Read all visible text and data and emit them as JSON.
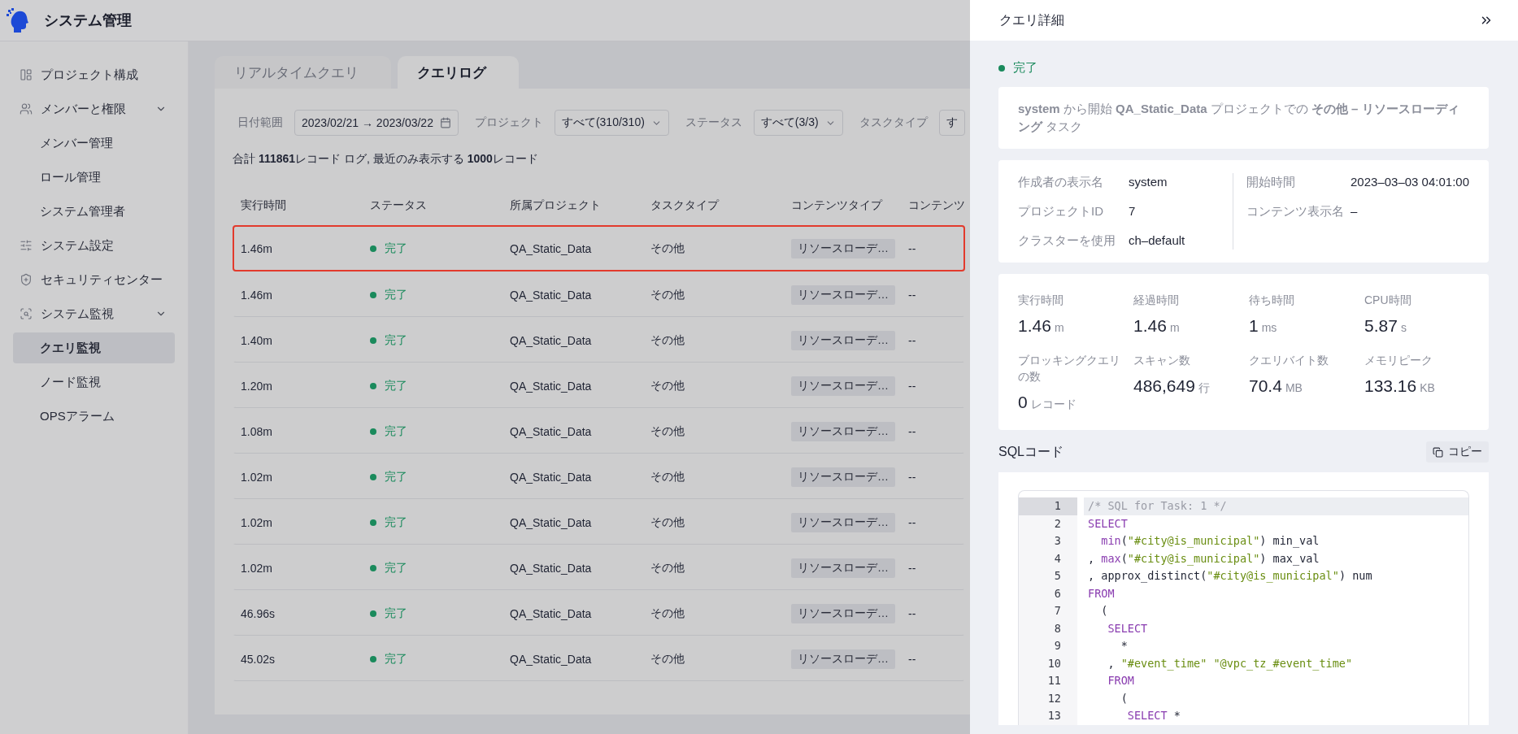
{
  "header": {
    "title": "システム管理"
  },
  "sidebar": {
    "items": [
      {
        "label": "プロジェクト構成",
        "selected": false
      },
      {
        "label": "メンバーと権限",
        "expanded": true,
        "selected": false,
        "children": [
          {
            "label": "メンバー管理",
            "selected": false
          },
          {
            "label": "ロール管理",
            "selected": false
          },
          {
            "label": "システム管理者",
            "selected": false
          }
        ]
      },
      {
        "label": "システム設定",
        "selected": false
      },
      {
        "label": "セキュリティセンター",
        "selected": false
      },
      {
        "label": "システム監視",
        "expanded": true,
        "selected": false,
        "children": [
          {
            "label": "クエリ監視",
            "selected": true
          },
          {
            "label": "ノード監視",
            "selected": false
          },
          {
            "label": "OPSアラーム",
            "selected": false
          }
        ]
      }
    ]
  },
  "tabs": [
    {
      "label": "リアルタイムクエリ",
      "selected": false
    },
    {
      "label": "クエリログ",
      "selected": true
    }
  ],
  "filters": [
    {
      "kind": "date",
      "label": "日付範囲",
      "value": "2023/02/21 → 2023/03/22"
    },
    {
      "kind": "select",
      "label": "プロジェクト",
      "value": "すべて(310/310)"
    },
    {
      "kind": "select",
      "label": "ステータス",
      "value": "すべて(3/3)"
    },
    {
      "kind": "select",
      "label": "タスクタイプ",
      "value": "す"
    }
  ],
  "summary": "合計 **111861**レコード ログ,  最近のみ表示する **1000**レコード",
  "table": {
    "columns": [
      "実行時間",
      "ステータス",
      "所属プロジェクト",
      "タスクタイプ",
      "コンテンツタイプ",
      "コンテンツ"
    ],
    "rows": [
      {
        "time": "1.46m",
        "status": "完了",
        "project": "QA_Static_Data",
        "task_type": "その他",
        "content_type": "リソースローデ…",
        "content_name": "--",
        "highlighted": true
      },
      {
        "time": "1.46m",
        "status": "完了",
        "project": "QA_Static_Data",
        "task_type": "その他",
        "content_type": "リソースローデ…",
        "content_name": "--",
        "highlighted": false
      },
      {
        "time": "1.40m",
        "status": "完了",
        "project": "QA_Static_Data",
        "task_type": "その他",
        "content_type": "リソースローデ…",
        "content_name": "--",
        "highlighted": false
      },
      {
        "time": "1.20m",
        "status": "完了",
        "project": "QA_Static_Data",
        "task_type": "その他",
        "content_type": "リソースローデ…",
        "content_name": "--",
        "highlighted": false
      },
      {
        "time": "1.08m",
        "status": "完了",
        "project": "QA_Static_Data",
        "task_type": "その他",
        "content_type": "リソースローデ…",
        "content_name": "--",
        "highlighted": false
      },
      {
        "time": "1.02m",
        "status": "完了",
        "project": "QA_Static_Data",
        "task_type": "その他",
        "content_type": "リソースローデ…",
        "content_name": "--",
        "highlighted": false
      },
      {
        "time": "1.02m",
        "status": "完了",
        "project": "QA_Static_Data",
        "task_type": "その他",
        "content_type": "リソースローデ…",
        "content_name": "--",
        "highlighted": false
      },
      {
        "time": "1.02m",
        "status": "完了",
        "project": "QA_Static_Data",
        "task_type": "その他",
        "content_type": "リソースローデ…",
        "content_name": "--",
        "highlighted": false
      },
      {
        "time": "46.96s",
        "status": "完了",
        "project": "QA_Static_Data",
        "task_type": "その他",
        "content_type": "リソースローデ…",
        "content_name": "--",
        "highlighted": false
      },
      {
        "time": "45.02s",
        "status": "完了",
        "project": "QA_Static_Data",
        "task_type": "その他",
        "content_type": "リソースローデ…",
        "content_name": "--",
        "highlighted": false
      }
    ]
  },
  "detail": {
    "title": "クエリ詳細",
    "status": "完了",
    "description": "**system** から開始 **QA_Static_Data** プロジェクトでの **その他 – リソースローディング** タスク",
    "info_left": [
      {
        "label": "作成者の表示名",
        "value": "system"
      },
      {
        "label": "プロジェクトID",
        "value": "7"
      },
      {
        "label": "クラスターを使用",
        "value": "ch–default"
      }
    ],
    "info_right": [
      {
        "label": "開始時間",
        "value": "2023–03–03 04:01:00"
      },
      {
        "label": "コンテンツ表示名",
        "value": "–"
      }
    ],
    "metrics": [
      {
        "label": "実行時間",
        "value": "1.46",
        "unit": "m"
      },
      {
        "label": "経過時間",
        "value": "1.46",
        "unit": "m"
      },
      {
        "label": "待ち時間",
        "value": "1",
        "unit": "ms"
      },
      {
        "label": "CPU時間",
        "value": "5.87",
        "unit": "s"
      },
      {
        "label": "ブロッキングクエリの数",
        "value": "0",
        "unit": "レコード"
      },
      {
        "label": "スキャン数",
        "value": "486,649",
        "unit": "行"
      },
      {
        "label": "クエリバイト数",
        "value": "70.4",
        "unit": "MB"
      },
      {
        "label": "メモリピーク",
        "value": "133.16",
        "unit": "KB"
      }
    ],
    "sql_title": "SQLコード",
    "copy_label": "コピー",
    "code": [
      {
        "number": "1",
        "active": true,
        "tokens": [
          {
            "kind": "comment",
            "text": "/* SQL for Task: 1 */"
          }
        ]
      },
      {
        "number": "2",
        "active": false,
        "tokens": [
          {
            "kind": "keyword",
            "text": "SELECT"
          }
        ]
      },
      {
        "number": "3",
        "active": false,
        "tokens": [
          {
            "kind": "keyword",
            "text": "  min"
          },
          {
            "kind": "plain",
            "text": "("
          },
          {
            "kind": "string",
            "text": "\"#city@is_municipal\""
          },
          {
            "kind": "plain",
            "text": ") min_val"
          }
        ]
      },
      {
        "number": "4",
        "active": false,
        "tokens": [
          {
            "kind": "plain",
            "text": ", "
          },
          {
            "kind": "keyword",
            "text": "max"
          },
          {
            "kind": "plain",
            "text": "("
          },
          {
            "kind": "string",
            "text": "\"#city@is_municipal\""
          },
          {
            "kind": "plain",
            "text": ") max_val"
          }
        ]
      },
      {
        "number": "5",
        "active": false,
        "tokens": [
          {
            "kind": "plain",
            "text": ", approx_distinct("
          },
          {
            "kind": "string",
            "text": "\"#city@is_municipal\""
          },
          {
            "kind": "plain",
            "text": ") num"
          }
        ]
      },
      {
        "number": "6",
        "active": false,
        "tokens": [
          {
            "kind": "keyword",
            "text": "FROM"
          }
        ]
      },
      {
        "number": "7",
        "active": false,
        "tokens": [
          {
            "kind": "plain",
            "text": "  ("
          }
        ]
      },
      {
        "number": "8",
        "active": false,
        "tokens": [
          {
            "kind": "keyword",
            "text": "   SELECT"
          }
        ]
      },
      {
        "number": "9",
        "active": false,
        "tokens": [
          {
            "kind": "plain",
            "text": "     *"
          }
        ]
      },
      {
        "number": "10",
        "active": false,
        "tokens": [
          {
            "kind": "plain",
            "text": "   , "
          },
          {
            "kind": "string",
            "text": "\"#event_time\""
          },
          {
            "kind": "string",
            "text": " \"@vpc_tz_#event_time\""
          }
        ]
      },
      {
        "number": "11",
        "active": false,
        "tokens": [
          {
            "kind": "keyword",
            "text": "   FROM"
          }
        ]
      },
      {
        "number": "12",
        "active": false,
        "tokens": [
          {
            "kind": "plain",
            "text": "     ("
          }
        ]
      },
      {
        "number": "13",
        "active": false,
        "tokens": [
          {
            "kind": "keyword",
            "text": "      SELECT"
          },
          {
            "kind": "plain",
            "text": " *"
          }
        ]
      }
    ]
  }
}
